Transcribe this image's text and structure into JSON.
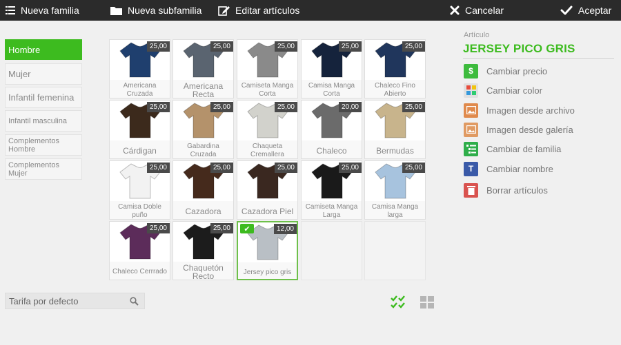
{
  "toolbar": {
    "new_family": "Nueva familia",
    "new_subfamily": "Nueva subfamilia",
    "edit_items": "Editar artículos",
    "cancel": "Cancelar",
    "accept": "Aceptar"
  },
  "families": [
    "Hombre",
    "Mujer",
    "Infantil femenina",
    "Infantil masculina",
    "Complementos Hombre",
    "Complementos Mujer"
  ],
  "products": [
    {
      "name": "Americana Cruzada",
      "price": "25,00",
      "color": "#1f3f6e"
    },
    {
      "name": "Americana Recta",
      "price": "25,00",
      "color": "#5a6470"
    },
    {
      "name": "Camiseta Manga Corta",
      "price": "25,00",
      "color": "#8a8a8a"
    },
    {
      "name": "Camisa Manga Corta",
      "price": "25,00",
      "color": "#15233c"
    },
    {
      "name": "Chaleco  Fino Abierto",
      "price": "25,00",
      "color": "#20365c"
    },
    {
      "name": "Cárdigan",
      "price": "25,00",
      "color": "#3c2a1c"
    },
    {
      "name": "Gabardina Cruzada",
      "price": "25,00",
      "color": "#b4926b"
    },
    {
      "name": "Chaqueta Cremallera",
      "price": "25,00",
      "color": "#d2d2cc"
    },
    {
      "name": "Chaleco",
      "price": "20,00",
      "color": "#6b6b6b"
    },
    {
      "name": "Bermudas",
      "price": "25,00",
      "color": "#c8b48c"
    },
    {
      "name": "Camisa Doble puño",
      "price": "25,00",
      "color": "#f2f2f2"
    },
    {
      "name": "Cazadora",
      "price": "25,00",
      "color": "#452a1c"
    },
    {
      "name": "Cazadora Piel",
      "price": "25,00",
      "color": "#3a2820"
    },
    {
      "name": "Camiseta Manga Larga",
      "price": "25,00",
      "color": "#1a1a1a"
    },
    {
      "name": "Camisa Manga larga",
      "price": "25,00",
      "color": "#a7c3de"
    },
    {
      "name": "Chaleco Cerrrado",
      "price": "25,00",
      "color": "#5c2c5a"
    },
    {
      "name": "Chaquetón Recto",
      "price": "25,00",
      "color": "#1c1c1c"
    },
    {
      "name": "Jersey pico gris",
      "price": "12,00",
      "color": "#b9bfc5",
      "selected": true
    }
  ],
  "search": {
    "tariff": "Tarifa por defecto"
  },
  "panel": {
    "label": "Artículo",
    "title": "JERSEY PICO GRIS",
    "actions": [
      {
        "label": "Cambiar precio",
        "icon": "price-icon",
        "color": "#3dbb3d",
        "glyph": "$"
      },
      {
        "label": "Cambiar color",
        "icon": "palette-icon",
        "color": "#e0e0e0",
        "glyph": ""
      },
      {
        "label": "Imagen desde archivo",
        "icon": "image-file-icon",
        "color": "#e08a4c",
        "glyph": ""
      },
      {
        "label": "Imagen desde galería",
        "icon": "gallery-icon",
        "color": "#e09a62",
        "glyph": ""
      },
      {
        "label": "Cambiar de familia",
        "icon": "family-icon",
        "color": "#2fae4a",
        "glyph": ""
      },
      {
        "label": "Cambiar nombre",
        "icon": "rename-icon",
        "color": "#3a5aa8",
        "glyph": "T"
      },
      {
        "label": "Borrar artículos",
        "icon": "delete-icon",
        "color": "#d9534f",
        "glyph": ""
      }
    ]
  },
  "colors": {
    "accent": "#3dbb1f",
    "toolbar": "#2b2b2b"
  }
}
